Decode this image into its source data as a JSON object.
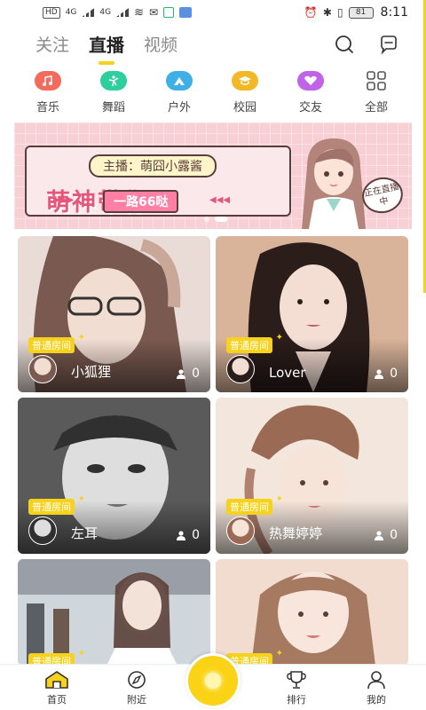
{
  "status_bar": {
    "left_badges": [
      "HD",
      "4G",
      "4G"
    ],
    "battery": "81",
    "time": "8:11"
  },
  "top_tabs": [
    {
      "label": "关注",
      "active": false
    },
    {
      "label": "直播",
      "active": true
    },
    {
      "label": "视频",
      "active": false
    }
  ],
  "top_icons": [
    "search-icon",
    "message-icon"
  ],
  "categories": [
    {
      "label": "音乐",
      "icon": "music-icon",
      "color": "#f46b5e"
    },
    {
      "label": "舞蹈",
      "icon": "dance-icon",
      "color": "#2fcf9d"
    },
    {
      "label": "户外",
      "icon": "outdoor-icon",
      "color": "#3fb0e6"
    },
    {
      "label": "校园",
      "icon": "campus-icon",
      "color": "#f2b828"
    },
    {
      "label": "交友",
      "icon": "friends-icon",
      "color": "#c163e8"
    },
    {
      "label": "全部",
      "icon": "grid-icon",
      "color": "#555555"
    }
  ],
  "banner": {
    "anchor": "主播：萌囧小露酱",
    "headline": "萌神带你飞",
    "sub": "一路66哒",
    "live_badge": "正在直播中",
    "active_slide": 1
  },
  "streams": [
    {
      "tag": "普通房间",
      "name": "小狐狸",
      "viewers": "0",
      "colors": [
        "#e9dcd6",
        "#c9a89a",
        "#7a5a50"
      ]
    },
    {
      "tag": "普通房间",
      "name": "Lover",
      "viewers": "0",
      "colors": [
        "#d9b39a",
        "#8a5a45",
        "#2a1d1a"
      ]
    },
    {
      "tag": "普通房间",
      "name": "左耳",
      "viewers": "0",
      "colors": [
        "#d8d8d8",
        "#8e8e8e",
        "#303030"
      ]
    },
    {
      "tag": "普通房间",
      "name": "热舞婷婷",
      "viewers": "0",
      "colors": [
        "#f3e6dc",
        "#d9b7a5",
        "#9a6a55"
      ]
    },
    {
      "tag": "普通房间",
      "name": "",
      "viewers": "",
      "colors": [
        "#cfd6dc",
        "#9a9ea6",
        "#5a5f66"
      ]
    },
    {
      "tag": "普通房间",
      "name": "",
      "viewers": "",
      "colors": [
        "#f1dccf",
        "#d8b39c",
        "#a57a60"
      ]
    }
  ],
  "bottom_nav": [
    {
      "label": "首页",
      "icon": "home-icon"
    },
    {
      "label": "附近",
      "icon": "compass-icon"
    },
    {
      "label": "排行",
      "icon": "trophy-icon"
    },
    {
      "label": "我的",
      "icon": "profile-icon"
    }
  ],
  "accent_color": "#f7d21c"
}
